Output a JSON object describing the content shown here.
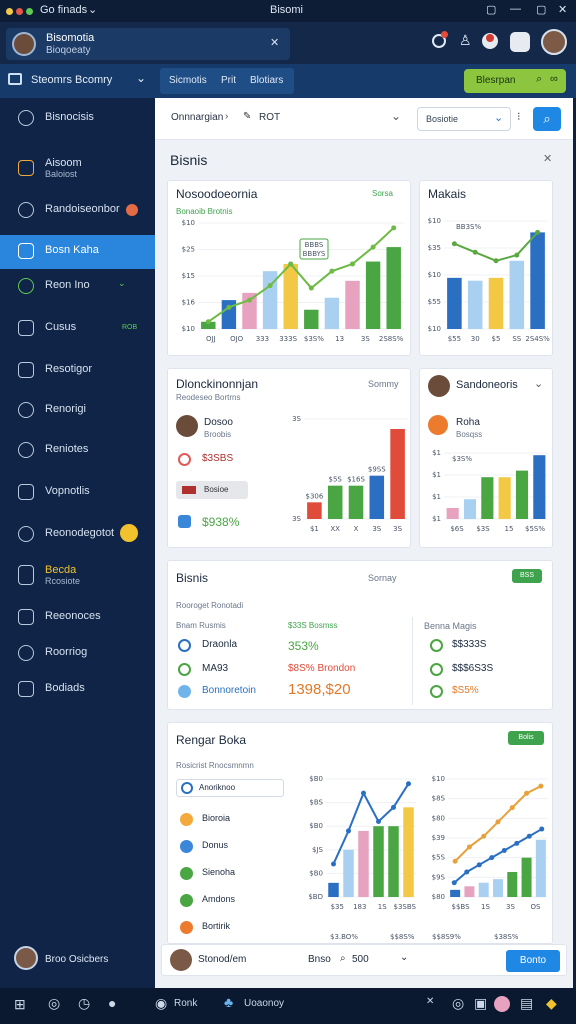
{
  "window": {
    "title": "Bisomi",
    "tab": "Go finads"
  },
  "appbar": {
    "user_name": "Bisomotia",
    "user_sub": "Bioqoeaty"
  },
  "subnav": {
    "workspace": "Steomrs Bcomry",
    "tabs": [
      "Sicmotis",
      "Prit",
      "Blotiars"
    ],
    "primary_button": "Blesrpan"
  },
  "sidebar": {
    "items": [
      {
        "label": "Bisnocisis",
        "icon": "search-icon"
      },
      {
        "label": "Aisoom",
        "sub": "Baloiost",
        "icon": "dashboard-icon"
      },
      {
        "label": "Randoiseonbor",
        "icon": "user-icon"
      },
      {
        "label": "Bosn Kaha",
        "icon": "folder-icon"
      },
      {
        "label": "Reon Ino",
        "icon": "refresh-icon"
      },
      {
        "label": "Cusus",
        "badge": "ROB",
        "icon": "stack-icon"
      },
      {
        "label": "Resotigor",
        "icon": "inbox-icon"
      },
      {
        "label": "Renorigi",
        "icon": "settings-icon"
      },
      {
        "label": "Reniotes",
        "icon": "globe-icon"
      },
      {
        "label": "Vopnotlis",
        "icon": "chart-icon"
      },
      {
        "label": "Reonodegotot",
        "icon": "gear-icon"
      },
      {
        "label": "Becda",
        "sub": "Rcosiote",
        "icon": "device-icon"
      },
      {
        "label": "Reeonoces",
        "icon": "list-icon"
      },
      {
        "label": "Roorriog",
        "icon": "pin-icon"
      },
      {
        "label": "Bodiads",
        "icon": "table-icon"
      }
    ],
    "footer_user": "Broo Osicbers"
  },
  "toolbar": {
    "breadcrumb": "Onnnargian",
    "crumb2": "ROT",
    "search_placeholder": "Bosiotie"
  },
  "section_title": "Bisnis",
  "card1": {
    "title": "Nosoodoeornia",
    "sub": "Bonaoib Brotnis",
    "tag": "Sorsa",
    "callout": "BBBS",
    "callout2": "BBBYS",
    "chart_data": {
      "type": "bar",
      "categories": [
        "1",
        "2",
        "3",
        "4",
        "5",
        "6",
        "7",
        "8",
        "9",
        "10"
      ],
      "values": [
        3,
        12,
        15,
        24,
        27,
        8,
        13,
        20,
        28,
        34
      ],
      "line": [
        3,
        9,
        12,
        18,
        27,
        17,
        24,
        27,
        34,
        42
      ],
      "ylabels": [
        "$10",
        "$16",
        "$15",
        "$25",
        "$10"
      ],
      "xlabels": [
        "OJJ",
        "OJO",
        "333",
        "333S",
        "$3S%",
        "13",
        "3S",
        "2S8S%"
      ]
    }
  },
  "card2": {
    "title": "Makais",
    "label": "BB3S%",
    "chart_data": {
      "type": "bar",
      "values": [
        18,
        17,
        18,
        24,
        34
      ],
      "line": [
        30,
        27,
        24,
        26,
        34
      ],
      "ylabels": [
        "$10",
        "$55",
        "$10",
        "$35",
        "$10"
      ],
      "xlabels": [
        "$55",
        "30",
        "$5",
        "SS",
        "2S4S%"
      ]
    }
  },
  "card3": {
    "title": "Dlonckinonnjan",
    "sub": "Reodeseo Bortrns",
    "tag": "Sommy",
    "person": {
      "name": "Dosoo",
      "sub": "Broobis"
    },
    "rows": [
      {
        "text": "$3SBS"
      },
      {
        "text": "Bosioe"
      },
      {
        "text": "$938%"
      }
    ],
    "chart_data": {
      "type": "bar",
      "categories": [
        "1",
        "2",
        "3",
        "4",
        "5"
      ],
      "values": [
        5,
        10,
        10,
        13,
        27
      ],
      "ylabels": [
        "3S",
        "3S"
      ],
      "xlabels": [
        "$1",
        "XX",
        "X",
        "3S",
        "3S"
      ],
      "labels": [
        "$306",
        "$5S",
        "$16S",
        "$9SS"
      ]
    }
  },
  "card4": {
    "title": "Sandoneoris",
    "person": {
      "name": "Roha",
      "sub": "Bosqss"
    },
    "label": "$3S%",
    "chart_data": {
      "type": "bar",
      "values": [
        5,
        9,
        19,
        19,
        22,
        29
      ],
      "ylabels": [
        "$1",
        "$1",
        "$1",
        "$1"
      ],
      "xlabels": [
        "$6S",
        "$3S",
        "15",
        "$5S%"
      ]
    }
  },
  "card5": {
    "title": "Bisnis",
    "tag": "Sornay",
    "button": "BSS",
    "sub": "Rooroget Ronotadi",
    "left_head": [
      "Bnam Rusmis",
      "$33S Bosmss"
    ],
    "left_rows": [
      {
        "label": "Draonla",
        "value": "353%"
      },
      {
        "label": "MA93",
        "value": "$8S% Brondon"
      },
      {
        "label": "Bonnoretoin",
        "value": "1398,$20"
      }
    ],
    "right_head": "Benna Magis",
    "right_rows": [
      {
        "value": "$$333S"
      },
      {
        "value": "$$$6S3S"
      },
      {
        "value": "$S5%"
      }
    ]
  },
  "card6": {
    "title": "Rengar Boka",
    "tag": "Bolis",
    "sub": "Rosicrist Rnocsmnmn",
    "list": [
      "Anoriknoo",
      "Bioroia",
      "Donus",
      "Sienoha",
      "Amdons",
      "Bortirik"
    ],
    "chart_a": {
      "type": "bar",
      "values": [
        6,
        20,
        28,
        30,
        30,
        38
      ],
      "line": [
        14,
        28,
        44,
        32,
        38,
        48
      ],
      "ylabels": [
        "$BD",
        "$B0",
        "$JS",
        "$B0",
        "$BS",
        "$B0"
      ],
      "xlabels": [
        "$35",
        "183",
        "1S",
        "$3SBS"
      ],
      "pct": [
        "$3.BO%",
        "$$8S%"
      ]
    },
    "chart_b": {
      "type": "bar",
      "values": [
        4,
        6,
        8,
        10,
        14,
        22,
        32
      ],
      "line": [
        8,
        14,
        18,
        22,
        26,
        30,
        34,
        38
      ],
      "line2": [
        20,
        28,
        34,
        42,
        50,
        58,
        62
      ],
      "ylabels": [
        "$80",
        "$9S",
        "$5S",
        "$39",
        "$80",
        "$8S",
        "$10"
      ],
      "xlabels": [
        "$$BS",
        "1S",
        "3S",
        "OS"
      ],
      "pct": [
        "$$8S9%",
        "$38S%"
      ]
    }
  },
  "footer": {
    "user": "Stonod/em",
    "label": "Bnso",
    "value": "500",
    "button": "Bonto"
  },
  "taskbar": {
    "item1": "Ronk",
    "item2": "Uoaonoy"
  },
  "colors": {
    "blue": "#2a6fc2",
    "green": "#4aa543",
    "yellow": "#f3c844",
    "pink": "#e7a2c0",
    "lightblue": "#a9d0f0",
    "red": "#e04b3a",
    "accent": "#1f88e5"
  }
}
